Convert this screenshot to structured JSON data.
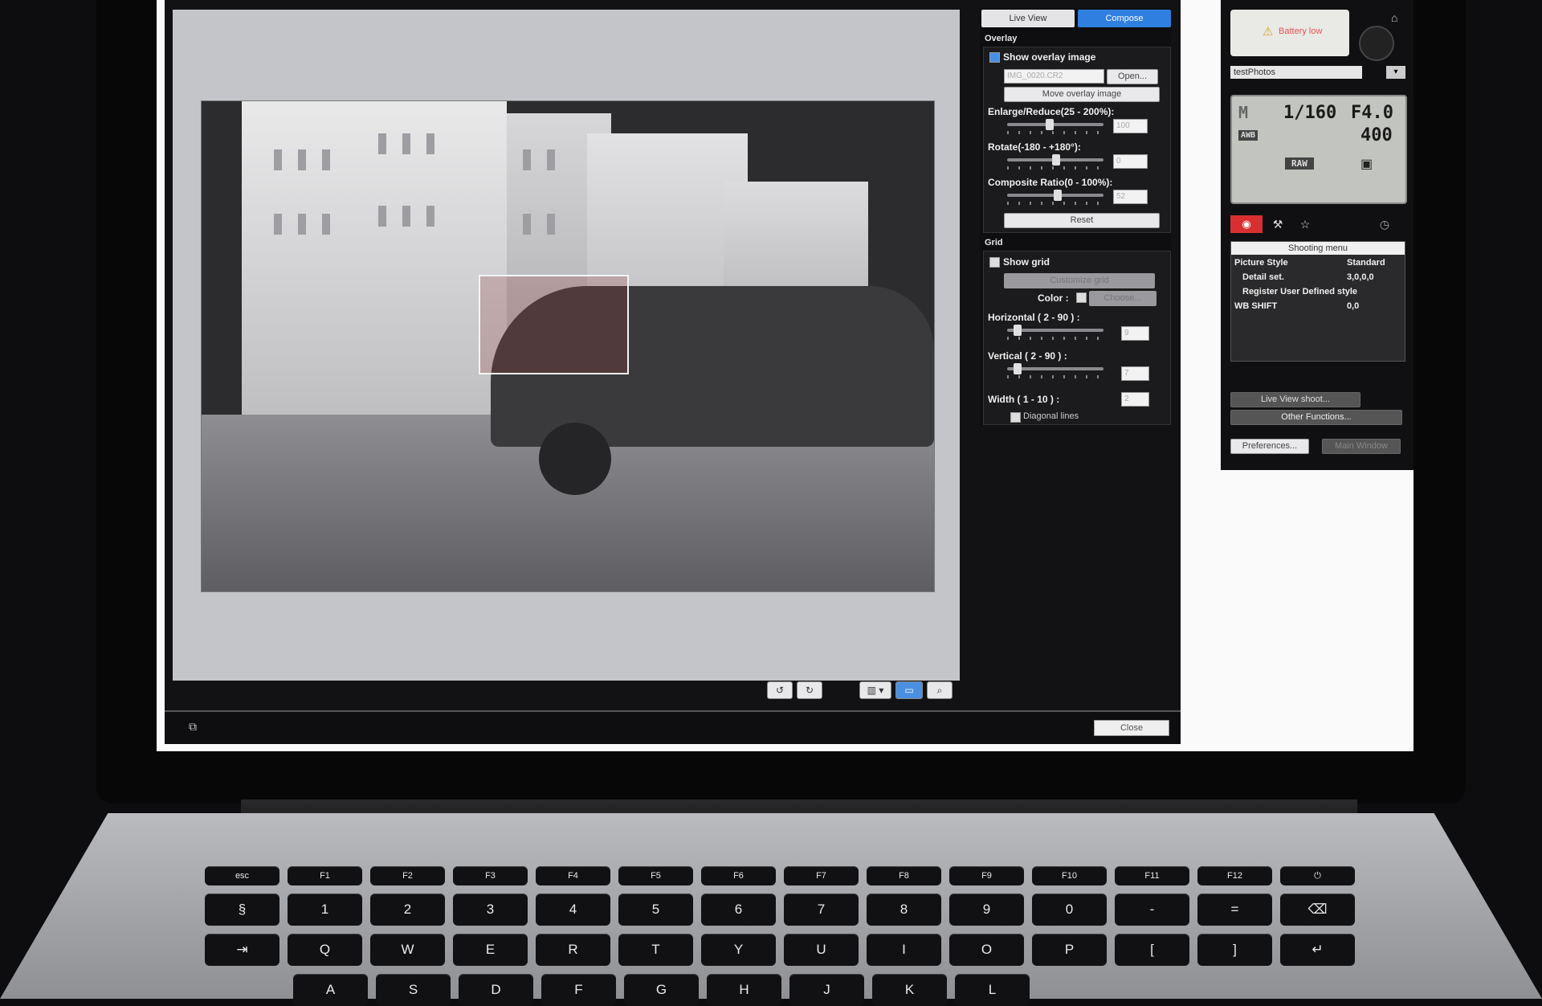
{
  "tabs": {
    "live_view": "Live View",
    "compose": "Compose"
  },
  "overlay": {
    "section_title": "Overlay",
    "show_overlay_label": "Show overlay image",
    "file_name": "IMG_0020.CR2",
    "open_label": "Open...",
    "move_label": "Move overlay image",
    "enlarge_label": "Enlarge/Reduce(25 - 200%):",
    "enlarge_value": "100",
    "rotate_label": "Rotate(-180 - +180°):",
    "rotate_value": "0",
    "ratio_label": "Composite Ratio(0 - 100%):",
    "ratio_value": "52",
    "reset_label": "Reset"
  },
  "grid": {
    "section_title": "Grid",
    "show_grid_label": "Show grid",
    "customize_label": "Customize grid",
    "color_label": "Color :",
    "choose_label": "Choose...",
    "horizontal_label": "Horizontal ( 2 - 90 ) :",
    "horizontal_value": "9",
    "vertical_label": "Vertical ( 2 - 90 ) :",
    "vertical_value": "7",
    "width_label": "Width ( 1 - 10 ) :",
    "width_value": "2",
    "diagonal_label": "Diagonal lines"
  },
  "footer": {
    "close_label": "Close"
  },
  "camera": {
    "battery_text": "Battery low",
    "folder": "testPhotos",
    "mode": "M",
    "shutter": "1/160",
    "aperture": "F4.0",
    "wb": "AWB",
    "iso": "400",
    "quality": "RAW",
    "menu_title": "Shooting menu",
    "menu_items": [
      {
        "label": "Picture Style",
        "value": "Standard"
      },
      {
        "label": "Detail set.",
        "value": "3,0,0,0"
      },
      {
        "label": "Register User Defined style",
        "value": ""
      },
      {
        "label": "WB SHIFT",
        "value": "0,0"
      }
    ],
    "live_view_shoot_label": "Live View shoot...",
    "other_functions_label": "Other Functions...",
    "preferences_label": "Preferences...",
    "main_window_label": "Main Window"
  },
  "keyboard": {
    "fn_row": [
      "esc",
      "F1",
      "F2",
      "F3",
      "F4",
      "F5",
      "F6",
      "F7",
      "F8",
      "F9",
      "F10",
      "F11",
      "F12",
      "⏻"
    ],
    "num_row": [
      "§",
      "1",
      "2",
      "3",
      "4",
      "5",
      "6",
      "7",
      "8",
      "9",
      "0",
      "-",
      "=",
      "⌫"
    ],
    "top_row": [
      "⇥",
      "Q",
      "W",
      "E",
      "R",
      "T",
      "Y",
      "U",
      "I",
      "O",
      "P",
      "[",
      "]",
      "↵"
    ],
    "home_row": [
      "A",
      "S",
      "D",
      "F",
      "G",
      "H",
      "J",
      "K",
      "L"
    ]
  },
  "colors": {
    "accent": "#2f7fe0",
    "panel_bg": "#0e0e10",
    "viewer_bg": "#c4c5c9"
  }
}
